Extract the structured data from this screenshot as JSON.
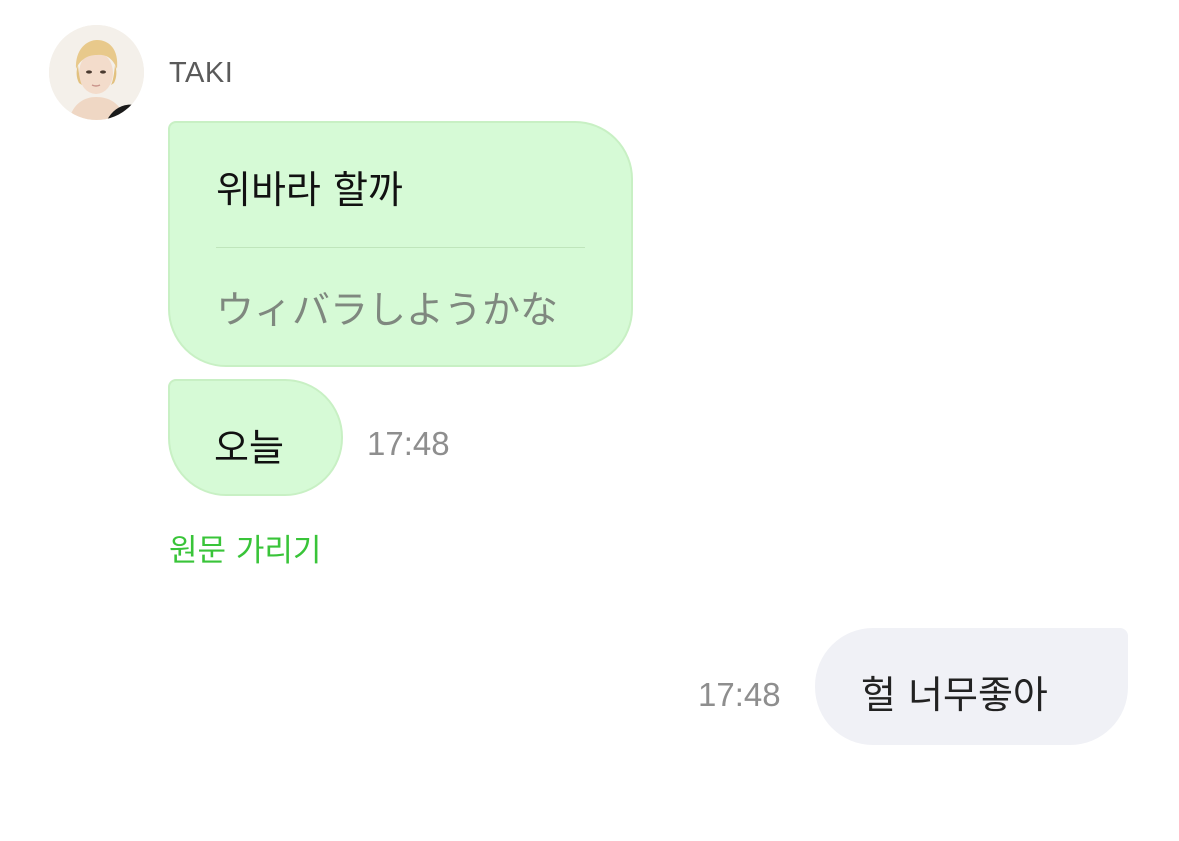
{
  "sender": {
    "name": "TAKI",
    "avatar_icon": "profile-photo"
  },
  "messages": [
    {
      "direction": "incoming",
      "text": "위바라 할까",
      "translation": "ウィバラしようかな"
    },
    {
      "direction": "incoming",
      "text": "오늘",
      "time": "17:48"
    },
    {
      "direction": "outgoing",
      "text": "헐 너무좋아",
      "time": "17:48"
    }
  ],
  "translation_toggle": "원문 가리기",
  "colors": {
    "incoming_bubble": "#d6fad6",
    "outgoing_bubble": "#f0f1f6",
    "accent_green": "#39c439"
  }
}
